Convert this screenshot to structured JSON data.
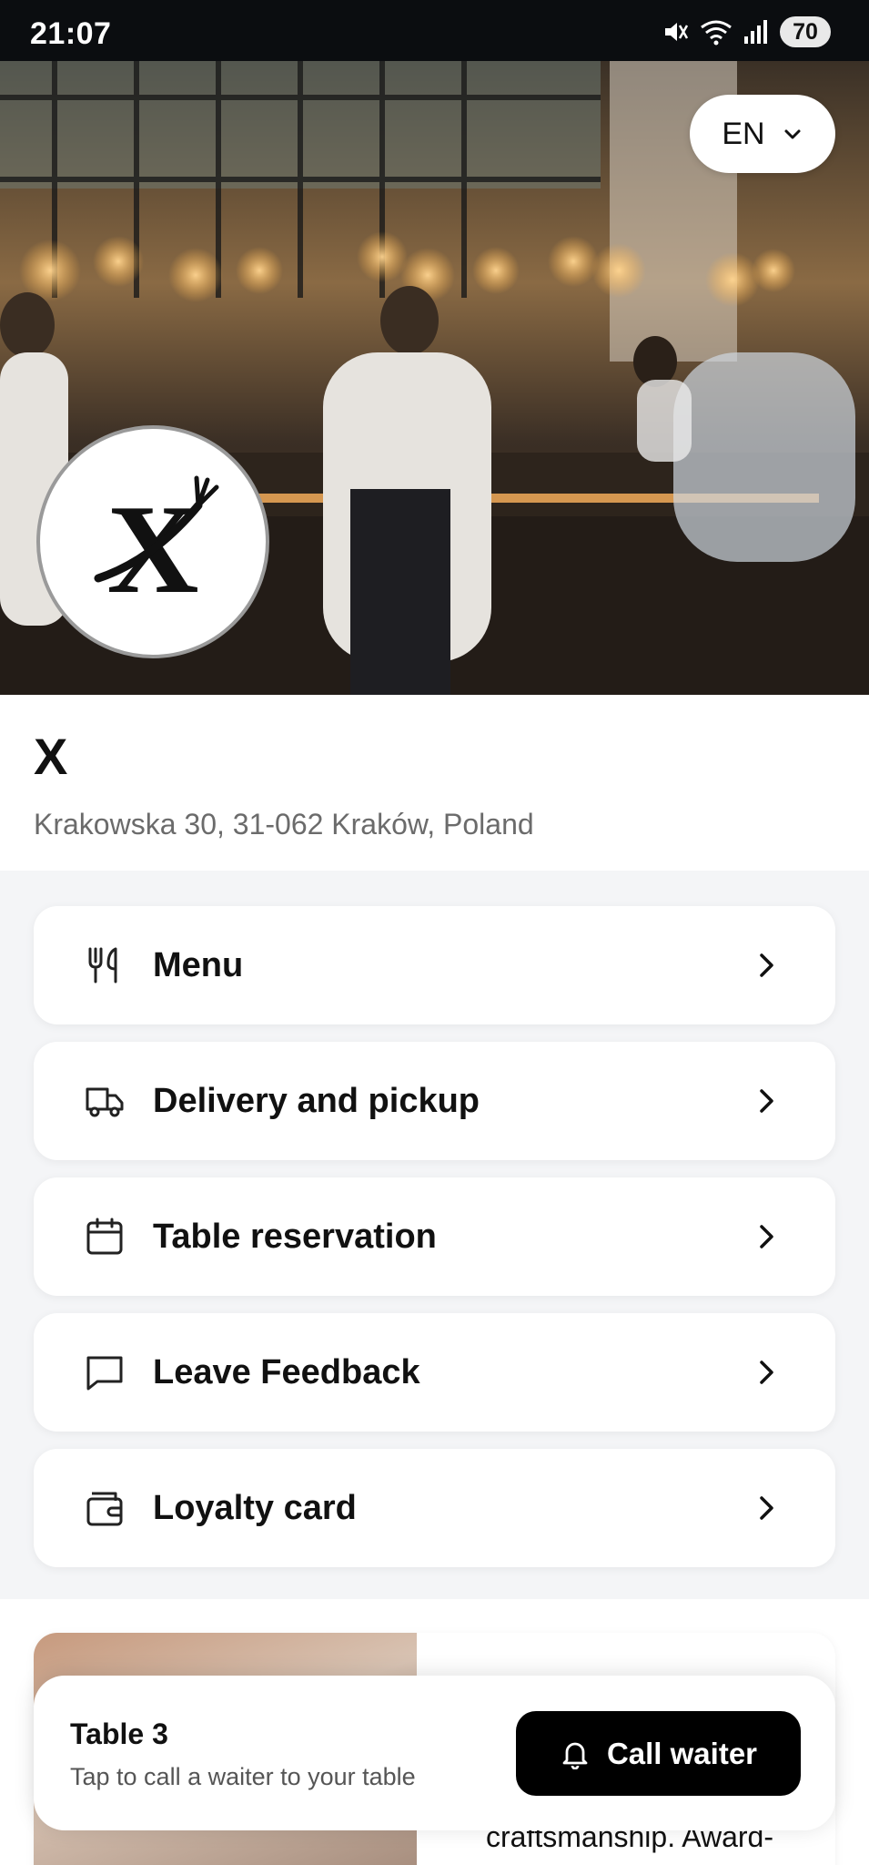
{
  "status_bar": {
    "time": "21:07",
    "battery": "70",
    "icons": [
      "mute-icon",
      "wifi-icon",
      "signal-icon"
    ]
  },
  "header": {
    "language": "EN",
    "language_icon": "chevron-down-icon"
  },
  "venue": {
    "logo_letter": "X",
    "name": "X",
    "address": "Krakowska 30, 31-062 Kraków, Poland"
  },
  "menu": {
    "items": [
      {
        "label": "Menu",
        "icon": "fork-knife-icon"
      },
      {
        "label": "Delivery and pickup",
        "icon": "truck-icon"
      },
      {
        "label": "Table reservation",
        "icon": "calendar-icon"
      },
      {
        "label": "Leave Feedback",
        "icon": "message-icon"
      },
      {
        "label": "Loyalty card",
        "icon": "wallet-icon"
      }
    ]
  },
  "promo": {
    "text": "craftsmanship. Award-"
  },
  "call_sheet": {
    "table_label": "Table 3",
    "hint": "Tap to call a waiter to your table",
    "button_label": "Call waiter",
    "button_icon": "bell-icon"
  },
  "colors": {
    "accent": "#000000",
    "page_bg": "#f4f5f7",
    "muted_text": "#6b6b6b"
  }
}
